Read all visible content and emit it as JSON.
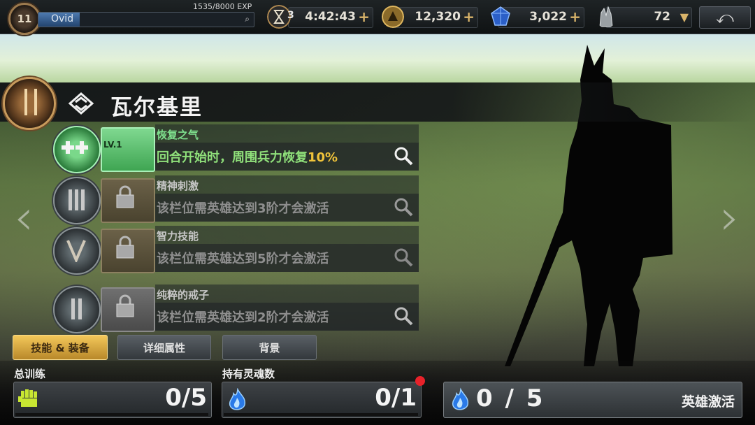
{
  "player": {
    "level": "11",
    "name": "Ovid",
    "exp": "1535/8000 EXP",
    "exp_fraction": 0.19
  },
  "resources": {
    "timer_count": "3",
    "timer": "4:42:43",
    "gold": "12,320",
    "gems": "3,022",
    "crystals": "72"
  },
  "hero": {
    "name": "瓦尔基里"
  },
  "skills": [
    {
      "name": "恢复之气",
      "level": "LV.1",
      "desc_pre": "回合开始时，周围兵力恢复",
      "desc_hl": "10%",
      "active": true
    },
    {
      "name": "精神刺激",
      "desc": "该栏位需英雄达到3阶才会激活",
      "active": false
    },
    {
      "name": "智力技能",
      "desc": "该栏位需英雄达到5阶才会激活",
      "active": false
    },
    {
      "name": "纯粹的戒子",
      "desc": "该栏位需英雄达到2阶才会激活",
      "active": false
    }
  ],
  "tabs": [
    {
      "label": "技能 & 装备",
      "active": true
    },
    {
      "label": "详细属性",
      "active": false
    },
    {
      "label": "背景",
      "active": false
    }
  ],
  "training": {
    "label": "总训练",
    "value": "0/5"
  },
  "souls": {
    "label": "持有灵魂数",
    "value": "0/1"
  },
  "activate": {
    "count": "0 / 5",
    "label": "英雄激活"
  },
  "nav": {
    "prev": "‹",
    "next": "›"
  },
  "colors": {
    "accent_gold": "#f4c85a",
    "active_green": "#7fe08e",
    "highlight": "#f0c33a",
    "notification": "#e8222a"
  }
}
